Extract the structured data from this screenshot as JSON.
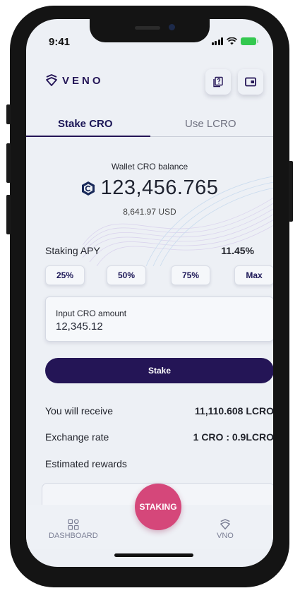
{
  "status": {
    "time": "9:41"
  },
  "brand": {
    "name": "VENO"
  },
  "tabs": [
    {
      "label": "Stake CRO",
      "active": true
    },
    {
      "label": "Use LCRO",
      "active": false
    }
  ],
  "balance": {
    "label": "Wallet CRO balance",
    "value": "123,456.765",
    "usd": "8,641.97 USD"
  },
  "apy": {
    "label": "Staking APY",
    "value": "11.45%"
  },
  "percent_buttons": [
    "25%",
    "50%",
    "75%",
    "Max"
  ],
  "amount_input": {
    "label": "Input CRO amount",
    "value": "12,345.12"
  },
  "stake_button": {
    "label": "Stake"
  },
  "info": [
    {
      "label": "You will receive",
      "value": "11,110.608 LCRO"
    },
    {
      "label": "Exchange rate",
      "value": "1 CRO : 0.9LCRO"
    },
    {
      "label": "Estimated rewards",
      "value": ""
    }
  ],
  "nav": {
    "dashboard": "DASHBOARD",
    "staking": "STAKING",
    "vno": "VNO"
  },
  "colors": {
    "brand_dark": "#241556",
    "staking_pink": "#d5477a",
    "background": "#edf0f5"
  }
}
